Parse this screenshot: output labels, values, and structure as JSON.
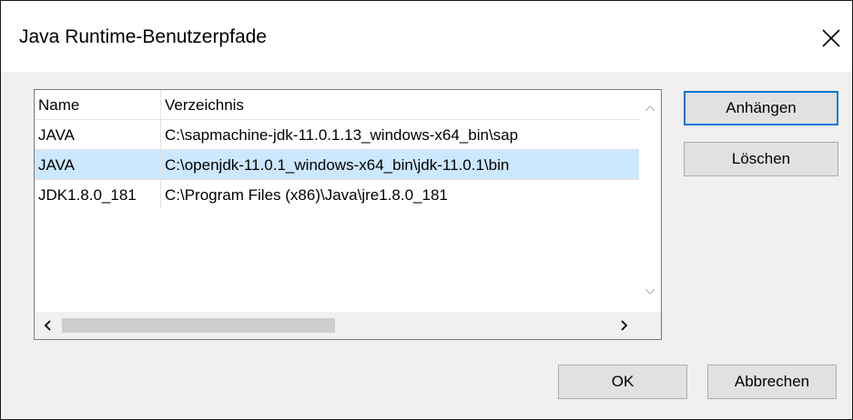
{
  "window": {
    "title": "Java Runtime-Benutzerpfade",
    "close_glyph": "close-icon"
  },
  "list": {
    "columns": [
      "Name",
      "Verzeichnis"
    ],
    "rows": [
      {
        "name": "JAVA",
        "dir": "C:\\sapmachine-jdk-11.0.1.13_windows-x64_bin\\sap",
        "selected": false
      },
      {
        "name": "JAVA",
        "dir": "C:\\openjdk-11.0.1_windows-x64_bin\\jdk-11.0.1\\bin",
        "selected": true
      },
      {
        "name": "JDK1.8.0_181",
        "dir": "C:\\Program Files (x86)\\Java\\jre1.8.0_181",
        "selected": false
      }
    ]
  },
  "buttons": {
    "append": "Anhängen",
    "delete": "Löschen",
    "ok": "OK",
    "cancel": "Abbrechen"
  },
  "colors": {
    "selection": "#cce8ff",
    "accent": "#0078d7",
    "button_face": "#e1e1e1"
  }
}
